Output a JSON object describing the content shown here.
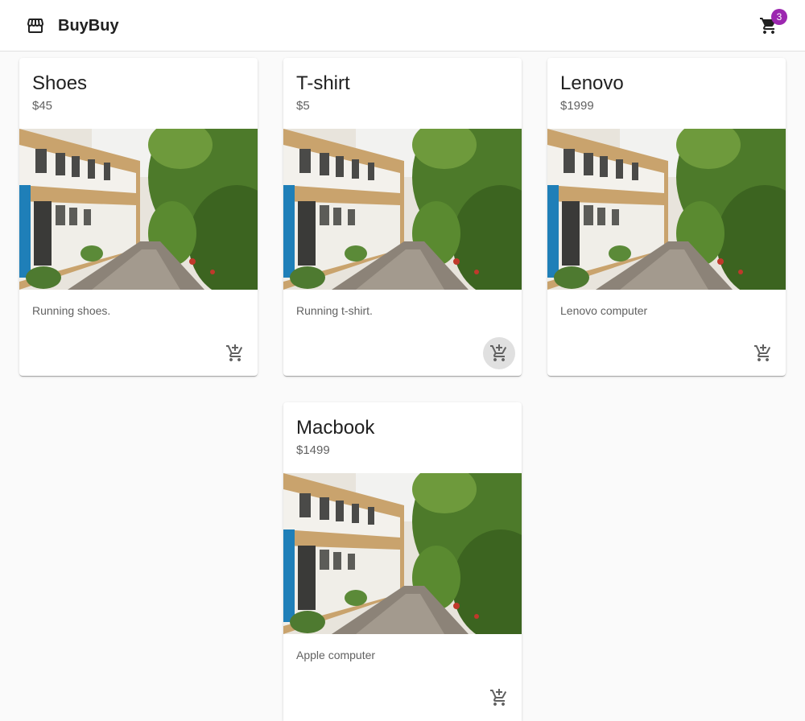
{
  "app": {
    "name": "BuyBuy",
    "brand_icon": "storefront-icon",
    "cart_icon": "shopping-cart-icon",
    "cart_count": "3"
  },
  "colors": {
    "badge": "#9c27b0",
    "appbar": "#ffffff",
    "background": "#fafafa"
  },
  "products": [
    {
      "title": "Shoes",
      "price": "$45",
      "description": "Running shoes.",
      "add_icon": "add-shopping-cart-icon"
    },
    {
      "title": "T-shirt",
      "price": "$5",
      "description": "Running t-shirt.",
      "add_icon": "add-shopping-cart-icon"
    },
    {
      "title": "Lenovo",
      "price": "$1999",
      "description": "Lenovo computer",
      "add_icon": "add-shopping-cart-icon"
    },
    {
      "title": "Macbook",
      "price": "$1499",
      "description": "Apple computer",
      "add_icon": "add-shopping-cart-icon"
    }
  ]
}
